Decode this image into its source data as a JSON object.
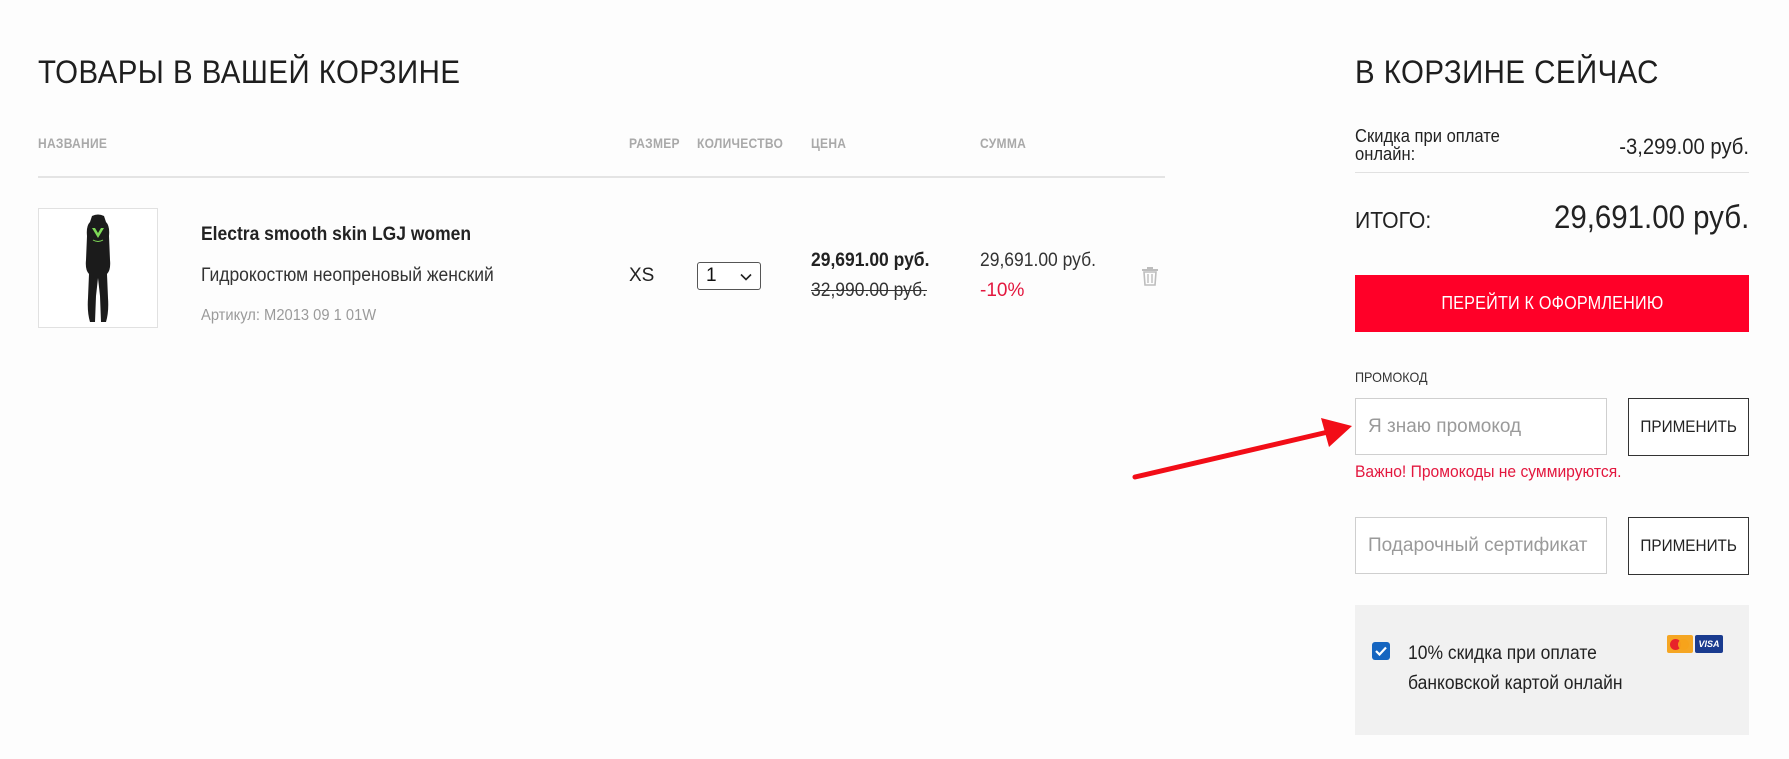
{
  "cart": {
    "title": "ТОВАРЫ В ВАШЕЙ КОРЗИНЕ",
    "columns": {
      "name": "НАЗВАНИЕ",
      "size": "РАЗМЕР",
      "quantity": "КОЛИЧЕСТВО",
      "price": "ЦЕНА",
      "sum": "СУММА"
    },
    "items": [
      {
        "name": "Electra smooth skin LGJ women",
        "description": "Гидрокостюм неопреновый женский",
        "sku": "Артикул: M2013 09 1 01W",
        "size": "XS",
        "quantity": "1",
        "price": "29,691.00 руб.",
        "old_price": "32,990.00 руб.",
        "sum": "29,691.00 руб.",
        "discount": "-10%",
        "thumbnail_icon": "wetsuit-image",
        "delete_icon": "trash-icon"
      }
    ]
  },
  "summary": {
    "title": "В КОРЗИНЕ СЕЙЧАС",
    "online_discount_label": "Скидка при оплате онлайн:",
    "online_discount_value": "-3,299.00 руб.",
    "total_label": "ИТОГО:",
    "total_value": "29,691.00 руб.",
    "checkout_button": "ПЕРЕЙТИ К ОФОРМЛЕНИЮ",
    "promo": {
      "label": "ПРОМОКОД",
      "placeholder": "Я знаю промокод",
      "apply_button": "ПРИМЕНИТЬ",
      "warning": "Важно! Промокоды не суммируются."
    },
    "gift": {
      "placeholder": "Подарочный сертификат",
      "apply_button": "ПРИМЕНИТЬ"
    },
    "online_payment": {
      "checked": true,
      "text": "10% скидка при оплате банковской картой онлайн",
      "logos": [
        "mastercard-logo",
        "visa-logo"
      ],
      "visa_text": "VISA"
    }
  },
  "colors": {
    "accent": "#ff0028",
    "discount": "#e3173e",
    "checkbox": "#1565c0",
    "annotation_arrow": "#f20d17"
  }
}
